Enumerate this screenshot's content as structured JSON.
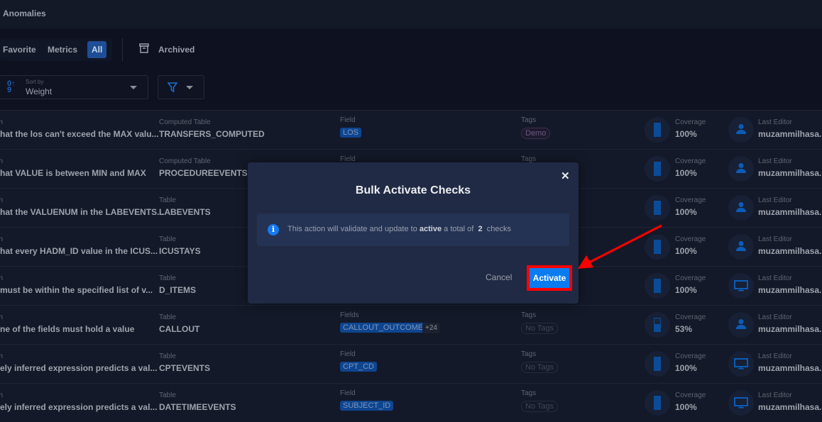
{
  "header": {
    "title": "Anomalies"
  },
  "toolbar": {
    "favorite": "Favorite",
    "metrics": "Metrics",
    "all": "All",
    "archived": "Archived",
    "sort_label": "Sort by",
    "sort_value": "Weight"
  },
  "labels": {
    "description_fragment": "n",
    "coverage": "Coverage",
    "last_editor": "Last Editor",
    "tags": "Tags"
  },
  "rows": [
    {
      "title": "hat the los can't exceed the MAX valu...",
      "table_label": "Computed Table",
      "table": "TRANSFERS_COMPUTED",
      "field_label": "Field",
      "field": "LOS",
      "tag": "Demo",
      "coverage": "100%",
      "coverage_fill": 1.0,
      "editor": "muzammilhasa...",
      "editor_icon": "person-icon"
    },
    {
      "title": "hat VALUE is between MIN and MAX",
      "table_label": "Computed Table",
      "table": "PROCEDUREEVENTS_M",
      "field_label": "Field",
      "coverage": "100%",
      "coverage_fill": 1.0,
      "editor": "muzammilhasa...",
      "editor_icon": "person-icon"
    },
    {
      "title": "hat the VALUENUM in the LABEVENTS...",
      "table_label": "Table",
      "table": "LABEVENTS",
      "coverage": "100%",
      "coverage_fill": 1.0,
      "editor": "muzammilhasa...",
      "editor_icon": "person-icon"
    },
    {
      "title": "hat every HADM_ID value in the ICUS...",
      "table_label": "Table",
      "table": "ICUSTAYS",
      "coverage": "100%",
      "coverage_fill": 1.0,
      "editor": "muzammilhasa...",
      "editor_icon": "person-icon"
    },
    {
      "title": " must be within the specified list of v...",
      "table_label": "Table",
      "table": "D_ITEMS",
      "coverage": "100%",
      "coverage_fill": 1.0,
      "editor": "muzammilhasa...",
      "editor_icon": "monitor-icon"
    },
    {
      "title": "ne of the fields must hold a value",
      "table_label": "Table",
      "table": "CALLOUT",
      "field_label": "Fields",
      "field": "CALLOUT_OUTCOME",
      "more": "+24",
      "tag_label": "Tags",
      "tag": "No Tags",
      "coverage": "53%",
      "coverage_fill": 0.53,
      "editor": "muzammilhasa...",
      "editor_icon": "person-icon"
    },
    {
      "title": "ely inferred expression predicts a val...",
      "table_label": "Table",
      "table": "CPTEVENTS",
      "field_label": "Field",
      "field": "CPT_CD",
      "tag_label": "Tags",
      "tag": "No Tags",
      "coverage": "100%",
      "coverage_fill": 1.0,
      "editor": "muzammilhasa...",
      "editor_icon": "monitor-icon"
    },
    {
      "title": "ely inferred expression predicts a val...",
      "table_label": "Table",
      "table": "DATETIMEEVENTS",
      "field_label": "Field",
      "field": "SUBJECT_ID",
      "tag_label": "Tags",
      "tag": "No Tags",
      "coverage": "100%",
      "coverage_fill": 1.0,
      "editor": "muzammilhasa...",
      "editor_icon": "monitor-icon"
    }
  ],
  "modal": {
    "title": "Bulk Activate Checks",
    "msg_pre": "This action will validate and update to ",
    "msg_bold": "active",
    "msg_mid": " a total of ",
    "count": "2",
    "msg_post": " checks",
    "cancel": "Cancel",
    "activate": "Activate"
  },
  "colors": {
    "accent": "#0b7cf0",
    "highlight": "#ff0000"
  }
}
